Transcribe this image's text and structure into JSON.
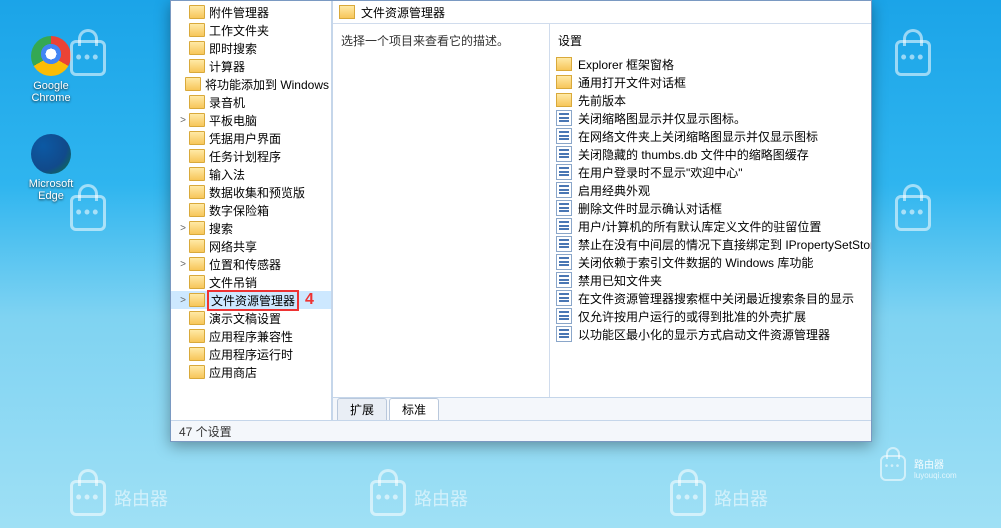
{
  "desktop": {
    "icons": [
      {
        "label": "Google Chrome"
      },
      {
        "label": "Microsoft Edge"
      }
    ]
  },
  "window": {
    "address": "文件资源管理器",
    "desc_hint": "选择一个项目来查看它的描述。",
    "settings_header": "设置",
    "status": "47 个设置",
    "tabs": {
      "ext": "扩展",
      "std": "标准"
    },
    "annotation": "4"
  },
  "tree": [
    {
      "label": "附件管理器",
      "exp": ""
    },
    {
      "label": "工作文件夹",
      "exp": ""
    },
    {
      "label": "即时搜索",
      "exp": ""
    },
    {
      "label": "计算器",
      "exp": ""
    },
    {
      "label": "将功能添加到 Windows",
      "exp": ""
    },
    {
      "label": "录音机",
      "exp": ""
    },
    {
      "label": "平板电脑",
      "exp": ">"
    },
    {
      "label": "凭据用户界面",
      "exp": ""
    },
    {
      "label": "任务计划程序",
      "exp": ""
    },
    {
      "label": "输入法",
      "exp": ""
    },
    {
      "label": "数据收集和预览版",
      "exp": ""
    },
    {
      "label": "数字保险箱",
      "exp": ""
    },
    {
      "label": "搜索",
      "exp": ">"
    },
    {
      "label": "网络共享",
      "exp": ""
    },
    {
      "label": "位置和传感器",
      "exp": ">"
    },
    {
      "label": "文件吊销",
      "exp": ""
    },
    {
      "label": "文件资源管理器",
      "exp": ">",
      "sel": true,
      "hi": true
    },
    {
      "label": "演示文稿设置",
      "exp": ""
    },
    {
      "label": "应用程序兼容性",
      "exp": ""
    },
    {
      "label": "应用程序运行时",
      "exp": ""
    },
    {
      "label": "应用商店",
      "exp": ""
    }
  ],
  "settings": [
    {
      "type": "folder",
      "label": "Explorer 框架窗格"
    },
    {
      "type": "folder",
      "label": "通用打开文件对话框"
    },
    {
      "type": "folder",
      "label": "先前版本"
    },
    {
      "type": "reg",
      "label": "关闭缩略图显示并仅显示图标。"
    },
    {
      "type": "reg",
      "label": "在网络文件夹上关闭缩略图显示并仅显示图标"
    },
    {
      "type": "reg",
      "label": "关闭隐藏的 thumbs.db 文件中的缩略图缓存"
    },
    {
      "type": "reg",
      "label": "在用户登录时不显示\"欢迎中心\""
    },
    {
      "type": "reg",
      "label": "启用经典外观"
    },
    {
      "type": "reg",
      "label": "删除文件时显示确认对话框"
    },
    {
      "type": "reg",
      "label": "用户/计算机的所有默认库定义文件的驻留位置"
    },
    {
      "type": "reg",
      "label": "禁止在没有中间层的情况下直接绑定到 IPropertySetStorage"
    },
    {
      "type": "reg",
      "label": "关闭依赖于索引文件数据的 Windows 库功能"
    },
    {
      "type": "reg",
      "label": "禁用已知文件夹"
    },
    {
      "type": "reg",
      "label": "在文件资源管理器搜索框中关闭最近搜索条目的显示"
    },
    {
      "type": "reg",
      "label": "仅允许按用户运行的或得到批准的外壳扩展"
    },
    {
      "type": "reg",
      "label": "以功能区最小化的显示方式启动文件资源管理器"
    }
  ],
  "watermark": "路由器",
  "watermark_sub": "luyouqi.com"
}
